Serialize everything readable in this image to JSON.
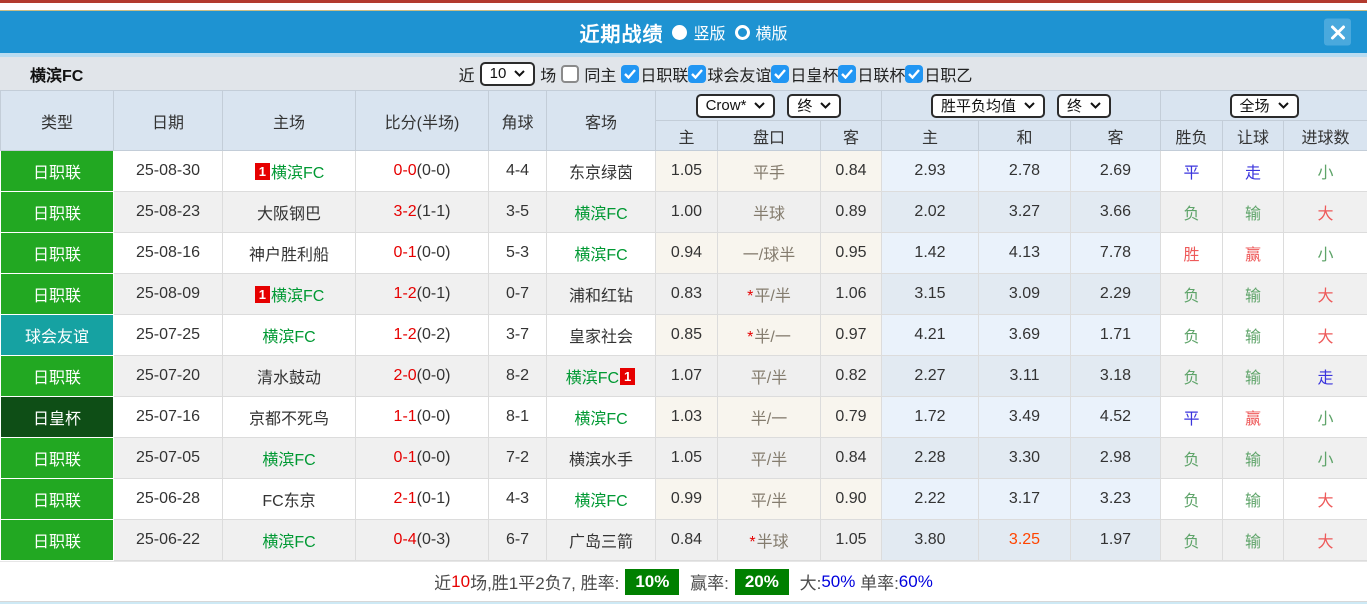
{
  "window": {
    "title": "近期战绩",
    "view_options": [
      {
        "label": "竖版",
        "selected": true
      },
      {
        "label": "横版",
        "selected": false
      }
    ],
    "close_glyph": "✕"
  },
  "filters": {
    "team": "横滨FC",
    "near_label": "近",
    "near_value": "10",
    "games_label": "场",
    "same_home": {
      "label": "同主",
      "checked": false
    },
    "leagues": [
      {
        "label": "日职联",
        "checked": true
      },
      {
        "label": "球会友谊",
        "checked": true
      },
      {
        "label": "日皇杯",
        "checked": true
      },
      {
        "label": "日联杯",
        "checked": true
      },
      {
        "label": "日职乙",
        "checked": true
      }
    ]
  },
  "table": {
    "static_headers": [
      "类型",
      "日期",
      "主场",
      "比分(半场)",
      "角球",
      "客场"
    ],
    "odds_group": {
      "company_select": "Crow*",
      "time_select": "终",
      "sub_headers": [
        "主",
        "盘口",
        "客"
      ]
    },
    "avg_group": {
      "label_select": "胜平负均值",
      "time_select": "终",
      "sub_headers": [
        "主",
        "和",
        "客"
      ]
    },
    "result_group": {
      "scope_select": "全场",
      "sub_headers": [
        "胜负",
        "让球",
        "进球数"
      ]
    },
    "rows": [
      {
        "type": {
          "label": "日职联",
          "color": "green"
        },
        "date": "25-08-30",
        "home": {
          "name": "横滨FC",
          "self": true,
          "badge": {
            "pos": "before",
            "text": "1"
          }
        },
        "score": {
          "ft": "0-0",
          "ht": "(0-0)"
        },
        "corner": "4-4",
        "away": {
          "name": "东京绿茵",
          "self": false,
          "badge": null
        },
        "crow": {
          "home": "1.05",
          "star": "",
          "handicap": "平手",
          "away": "0.84"
        },
        "avg": {
          "values": [
            "2.93",
            "2.78",
            "2.69"
          ],
          "highlight": null
        },
        "result": [
          {
            "text": "平",
            "color": "blue"
          },
          {
            "text": "走",
            "color": "blue"
          },
          {
            "text": "小",
            "color": "green"
          }
        ]
      },
      {
        "type": {
          "label": "日职联",
          "color": "green"
        },
        "date": "25-08-23",
        "home": {
          "name": "大阪钢巴",
          "self": false,
          "badge": null
        },
        "score": {
          "ft": "3-2",
          "ht": "(1-1)"
        },
        "corner": "3-5",
        "away": {
          "name": "横滨FC",
          "self": true,
          "badge": null
        },
        "crow": {
          "home": "1.00",
          "star": "",
          "handicap": "半球",
          "away": "0.89"
        },
        "avg": {
          "values": [
            "2.02",
            "3.27",
            "3.66"
          ],
          "highlight": null
        },
        "result": [
          {
            "text": "负",
            "color": "green"
          },
          {
            "text": "输",
            "color": "green"
          },
          {
            "text": "大",
            "color": "red"
          }
        ]
      },
      {
        "type": {
          "label": "日职联",
          "color": "green"
        },
        "date": "25-08-16",
        "home": {
          "name": "神户胜利船",
          "self": false,
          "badge": null
        },
        "score": {
          "ft": "0-1",
          "ht": "(0-0)"
        },
        "corner": "5-3",
        "away": {
          "name": "横滨FC",
          "self": true,
          "badge": null
        },
        "crow": {
          "home": "0.94",
          "star": "",
          "handicap": "一/球半",
          "away": "0.95"
        },
        "avg": {
          "values": [
            "1.42",
            "4.13",
            "7.78"
          ],
          "highlight": null
        },
        "result": [
          {
            "text": "胜",
            "color": "red"
          },
          {
            "text": "赢",
            "color": "red"
          },
          {
            "text": "小",
            "color": "green"
          }
        ]
      },
      {
        "type": {
          "label": "日职联",
          "color": "green"
        },
        "date": "25-08-09",
        "home": {
          "name": "横滨FC",
          "self": true,
          "badge": {
            "pos": "before",
            "text": "1"
          }
        },
        "score": {
          "ft": "1-2",
          "ht": "(0-1)"
        },
        "corner": "0-7",
        "away": {
          "name": "浦和红钻",
          "self": false,
          "badge": null
        },
        "crow": {
          "home": "0.83",
          "star": "*",
          "handicap": "平/半",
          "away": "1.06"
        },
        "avg": {
          "values": [
            "3.15",
            "3.09",
            "2.29"
          ],
          "highlight": null
        },
        "result": [
          {
            "text": "负",
            "color": "green"
          },
          {
            "text": "输",
            "color": "green"
          },
          {
            "text": "大",
            "color": "red"
          }
        ]
      },
      {
        "type": {
          "label": "球会友谊",
          "color": "teal"
        },
        "date": "25-07-25",
        "home": {
          "name": "横滨FC",
          "self": true,
          "badge": null
        },
        "score": {
          "ft": "1-2",
          "ht": "(0-2)"
        },
        "corner": "3-7",
        "away": {
          "name": "皇家社会",
          "self": false,
          "badge": null
        },
        "crow": {
          "home": "0.85",
          "star": "*",
          "handicap": "半/一",
          "away": "0.97"
        },
        "avg": {
          "values": [
            "4.21",
            "3.69",
            "1.71"
          ],
          "highlight": null
        },
        "result": [
          {
            "text": "负",
            "color": "green"
          },
          {
            "text": "输",
            "color": "green"
          },
          {
            "text": "大",
            "color": "red"
          }
        ]
      },
      {
        "type": {
          "label": "日职联",
          "color": "green"
        },
        "date": "25-07-20",
        "home": {
          "name": "清水鼓动",
          "self": false,
          "badge": null
        },
        "score": {
          "ft": "2-0",
          "ht": "(0-0)"
        },
        "corner": "8-2",
        "away": {
          "name": "横滨FC",
          "self": true,
          "badge": {
            "pos": "after",
            "text": "1"
          }
        },
        "crow": {
          "home": "1.07",
          "star": "",
          "handicap": "平/半",
          "away": "0.82"
        },
        "avg": {
          "values": [
            "2.27",
            "3.11",
            "3.18"
          ],
          "highlight": null
        },
        "result": [
          {
            "text": "负",
            "color": "green"
          },
          {
            "text": "输",
            "color": "green"
          },
          {
            "text": "走",
            "color": "blue"
          }
        ]
      },
      {
        "type": {
          "label": "日皇杯",
          "color": "darkgreen"
        },
        "date": "25-07-16",
        "home": {
          "name": "京都不死鸟",
          "self": false,
          "badge": null
        },
        "score": {
          "ft": "1-1",
          "ht": "(0-0)"
        },
        "corner": "8-1",
        "away": {
          "name": "横滨FC",
          "self": true,
          "badge": null
        },
        "crow": {
          "home": "1.03",
          "star": "",
          "handicap": "半/一",
          "away": "0.79"
        },
        "avg": {
          "values": [
            "1.72",
            "3.49",
            "4.52"
          ],
          "highlight": null
        },
        "result": [
          {
            "text": "平",
            "color": "blue"
          },
          {
            "text": "赢",
            "color": "red"
          },
          {
            "text": "小",
            "color": "green"
          }
        ]
      },
      {
        "type": {
          "label": "日职联",
          "color": "green"
        },
        "date": "25-07-05",
        "home": {
          "name": "横滨FC",
          "self": true,
          "badge": null
        },
        "score": {
          "ft": "0-1",
          "ht": "(0-0)"
        },
        "corner": "7-2",
        "away": {
          "name": "横滨水手",
          "self": false,
          "badge": null
        },
        "crow": {
          "home": "1.05",
          "star": "",
          "handicap": "平/半",
          "away": "0.84"
        },
        "avg": {
          "values": [
            "2.28",
            "3.30",
            "2.98"
          ],
          "highlight": null
        },
        "result": [
          {
            "text": "负",
            "color": "green"
          },
          {
            "text": "输",
            "color": "green"
          },
          {
            "text": "小",
            "color": "green"
          }
        ]
      },
      {
        "type": {
          "label": "日职联",
          "color": "green"
        },
        "date": "25-06-28",
        "home": {
          "name": "FC东京",
          "self": false,
          "badge": null
        },
        "score": {
          "ft": "2-1",
          "ht": "(0-1)"
        },
        "corner": "4-3",
        "away": {
          "name": "横滨FC",
          "self": true,
          "badge": null
        },
        "crow": {
          "home": "0.99",
          "star": "",
          "handicap": "平/半",
          "away": "0.90"
        },
        "avg": {
          "values": [
            "2.22",
            "3.17",
            "3.23"
          ],
          "highlight": null
        },
        "result": [
          {
            "text": "负",
            "color": "green"
          },
          {
            "text": "输",
            "color": "green"
          },
          {
            "text": "大",
            "color": "red"
          }
        ]
      },
      {
        "type": {
          "label": "日职联",
          "color": "green"
        },
        "date": "25-06-22",
        "home": {
          "name": "横滨FC",
          "self": true,
          "badge": null
        },
        "score": {
          "ft": "0-4",
          "ht": "(0-3)"
        },
        "corner": "6-7",
        "away": {
          "name": "广岛三箭",
          "self": false,
          "badge": null
        },
        "crow": {
          "home": "0.84",
          "star": "*",
          "handicap": "半球",
          "away": "1.05"
        },
        "avg": {
          "values": [
            "3.80",
            "3.25",
            "1.97"
          ],
          "highlight": 1
        },
        "result": [
          {
            "text": "负",
            "color": "green"
          },
          {
            "text": "输",
            "color": "green"
          },
          {
            "text": "大",
            "color": "red"
          }
        ]
      }
    ]
  },
  "footer": {
    "segments": [
      {
        "text": "近",
        "style": "dark"
      },
      {
        "text": "10",
        "style": "red"
      },
      {
        "text": "场,胜1平2负7, 胜率:",
        "style": "dark"
      },
      {
        "text": "10%",
        "style": "badge"
      },
      {
        "text": " 赢率:",
        "style": "dark"
      },
      {
        "text": "20%",
        "style": "badge"
      },
      {
        "text": " 大:",
        "style": "dark"
      },
      {
        "text": "50%",
        "style": "blue"
      },
      {
        "text": " 单率:",
        "style": "dark"
      },
      {
        "text": "60%",
        "style": "blue"
      }
    ]
  },
  "colors": {
    "accent_blue": "#1e93d2",
    "league_green": "#22a822",
    "friendly_teal": "#16a2a2",
    "cup_darkgreen": "#0e4e16",
    "team_green": "#009933",
    "score_red": "#e60000",
    "rate_badge_green": "#008000",
    "checkbox_blue": "#2196f3"
  }
}
